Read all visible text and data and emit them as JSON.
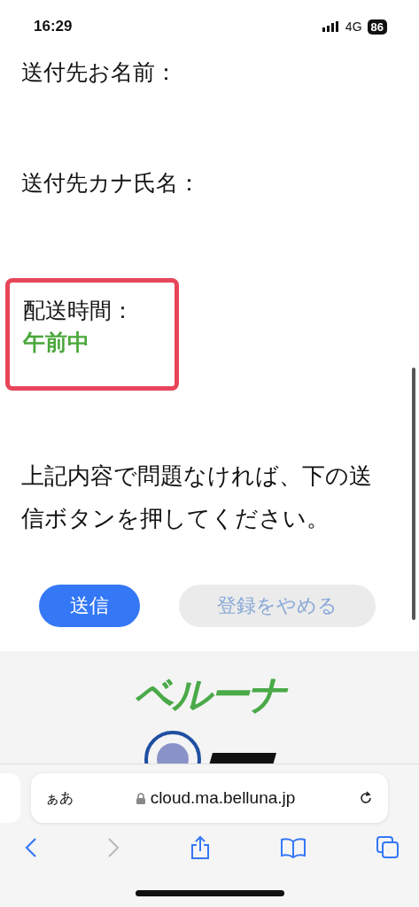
{
  "status_bar": {
    "time": "16:29",
    "network": "4G",
    "battery": "86"
  },
  "fields": [
    {
      "label": "送付先お名前：",
      "highlighted": false
    },
    {
      "label": "送付先カナ氏名：",
      "highlighted": false
    },
    {
      "label": "配送時間：",
      "value": "午前中",
      "highlighted": true
    }
  ],
  "message": "上記内容で問題なければ、下の送信ボタンを押してください。",
  "buttons": [
    {
      "label": "送信",
      "kind": "primary"
    },
    {
      "label": "登録をやめる",
      "kind": "secondary"
    }
  ],
  "footer": {
    "logo": "ベルーナ"
  },
  "browser": {
    "text_size": "ぁあ",
    "url": "cloud.ma.belluna.jp",
    "back_disabled": false,
    "forward_disabled": true
  }
}
